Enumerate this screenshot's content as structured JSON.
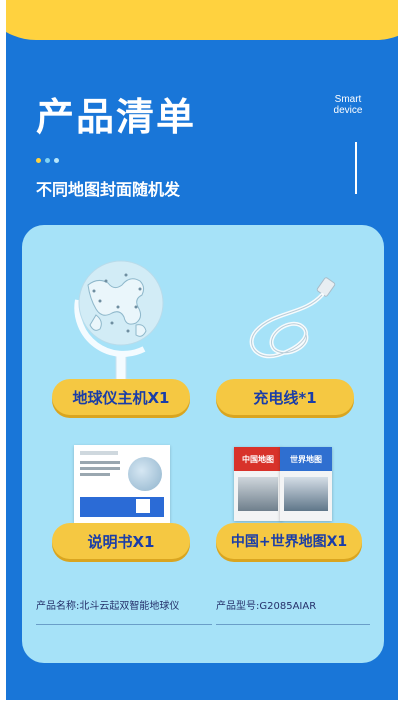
{
  "header": {
    "title": "产品清单",
    "badge_line1": "Smart",
    "badge_line2": "device",
    "subtitle": "不同地图封面随机发"
  },
  "items": [
    {
      "label": "地球仪主机X1"
    },
    {
      "label": "充电线*1"
    },
    {
      "label": "说明书X1"
    },
    {
      "label": "中国+世界地图X1"
    }
  ],
  "map_covers": {
    "china": "中国地图",
    "world": "世界地图"
  },
  "info": {
    "name": "产品名称:北斗云起双智能地球仪",
    "model": "产品型号:G2085AIAR"
  },
  "colors": {
    "background": "#1976d8",
    "accent_yellow": "#ffd23f",
    "card": "#a6e2f8",
    "pill": "#f5c842",
    "pill_text": "#1a3da8"
  }
}
